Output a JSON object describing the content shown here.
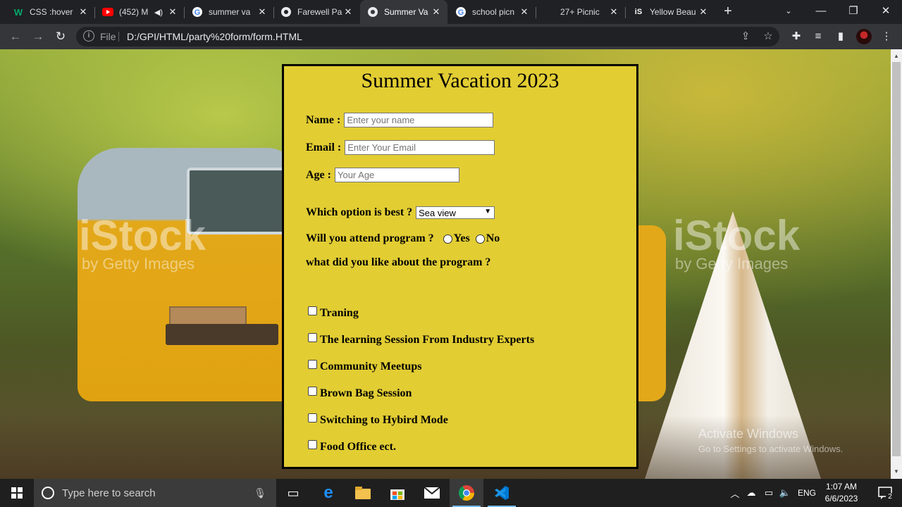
{
  "browser": {
    "tabs": [
      {
        "title": "CSS :hover",
        "icon": "w-logo"
      },
      {
        "title": "(452) M",
        "icon": "youtube"
      },
      {
        "title": "summer va",
        "icon": "google"
      },
      {
        "title": "Farewell Pa",
        "icon": "chrome"
      },
      {
        "title": "Summer Va",
        "icon": "chrome",
        "active": true
      },
      {
        "title": "school picn",
        "icon": "google"
      },
      {
        "title": "27+ Picnic",
        "icon": "blank"
      },
      {
        "title": "Yellow Beau",
        "icon": "istock"
      }
    ],
    "new_tab": "+",
    "minimize": "—",
    "restore": "❐",
    "close": "✕",
    "omnibox_scheme": "File",
    "url": "D:/GPI/HTML/party%20form/form.HTML"
  },
  "form": {
    "title": "Summer Vacation 2023",
    "name_label": "Name :",
    "name_placeholder": "Enter your name",
    "email_label": "Email :",
    "email_placeholder": "Enter Your Email",
    "age_label": "Age :",
    "age_placeholder": "Your Age",
    "option_label": "Which option is best ?",
    "option_selected": "Sea view",
    "attend_label": "Will you attend program ?",
    "attend_yes": "Yes",
    "attend_no": "No",
    "like_label": "what did you like about the program ?",
    "checkboxes": [
      "Traning",
      "The learning Session From Industry Experts",
      "Community Meetups",
      "Brown Bag Session",
      "Switching to Hybird Mode",
      "Food Office ect."
    ],
    "background_color": "#e2cd33"
  },
  "watermark": {
    "brand": "iStock",
    "byline": "by Getty Images",
    "activate_title": "Activate Windows",
    "activate_sub": "Go to Settings to activate Windows."
  },
  "taskbar": {
    "search_placeholder": "Type here to search",
    "language": "ENG",
    "time": "1:07 AM",
    "date": "6/6/2023",
    "notification_count": "2"
  }
}
